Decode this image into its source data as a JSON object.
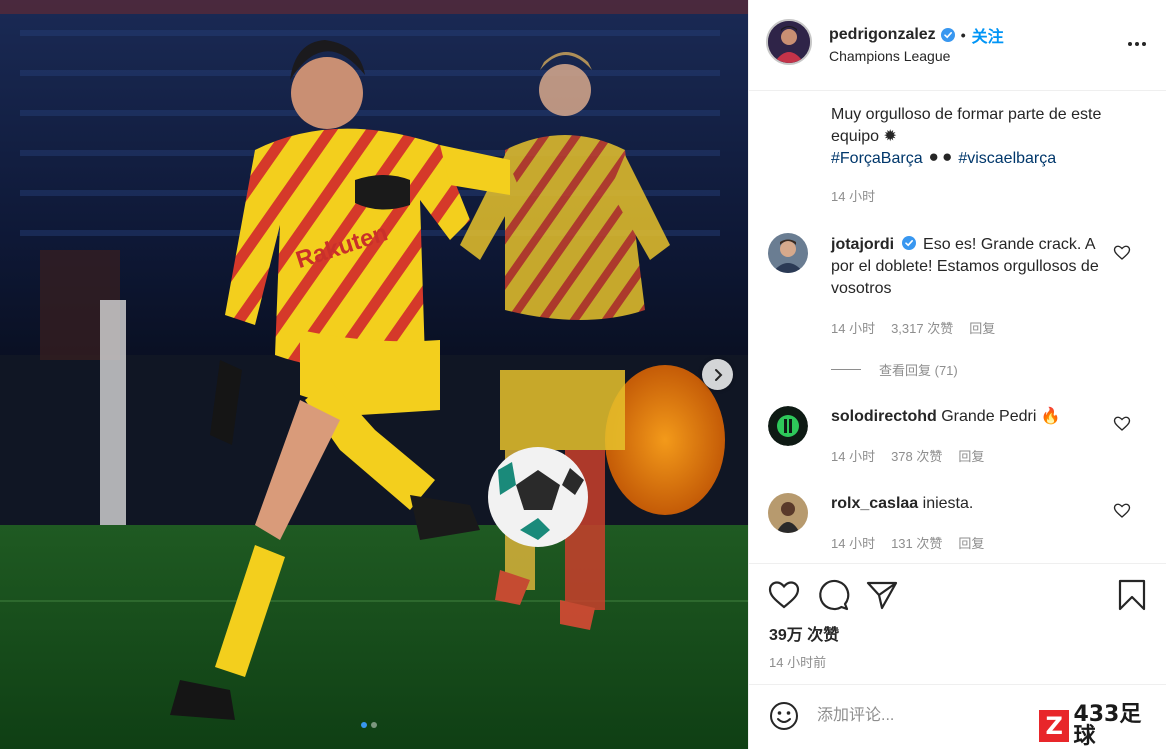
{
  "post": {
    "username": "pedrigonzalez",
    "separator": "•",
    "follow_label": "关注",
    "location": "Champions League",
    "caption_text": "Muy orgulloso de formar parte de este equipo ✹",
    "caption_tag1": "#ForçaBarça",
    "caption_emoji": "⚫⚫",
    "caption_tag2": "#viscaelbarça",
    "caption_time": "14 小时"
  },
  "media": {
    "image_dots": 2,
    "active_dot": 1,
    "sponsor_text": "Rakuten"
  },
  "comments": [
    {
      "user": "jotajordi",
      "verified": true,
      "text": "Eso es! Grande crack. A por el doblete! Estamos orgullosos de vosotros",
      "time": "14 小时",
      "likes": "3,317 次赞",
      "reply": "回复",
      "view_replies": "查看回复 (71)"
    },
    {
      "user": "solodirectohd",
      "verified": false,
      "text": "Grande Pedri 🔥",
      "time": "14 小时",
      "likes": "378 次赞",
      "reply": "回复"
    },
    {
      "user": "rolx_caslaa",
      "verified": false,
      "text": "iniesta.",
      "time": "14 小时",
      "likes": "131 次赞",
      "reply": "回复"
    }
  ],
  "actions": {
    "likes_count": "39万 次赞",
    "posted_time": "14 小时前"
  },
  "add_comment": {
    "placeholder": "添加评论..."
  },
  "watermark": {
    "logo_letter": "Z",
    "logo_text": "433足球"
  },
  "colors": {
    "follow": "#0095f6",
    "hashtag": "#00376b",
    "verified": "#3897f0",
    "muted": "#8e8e8e"
  }
}
